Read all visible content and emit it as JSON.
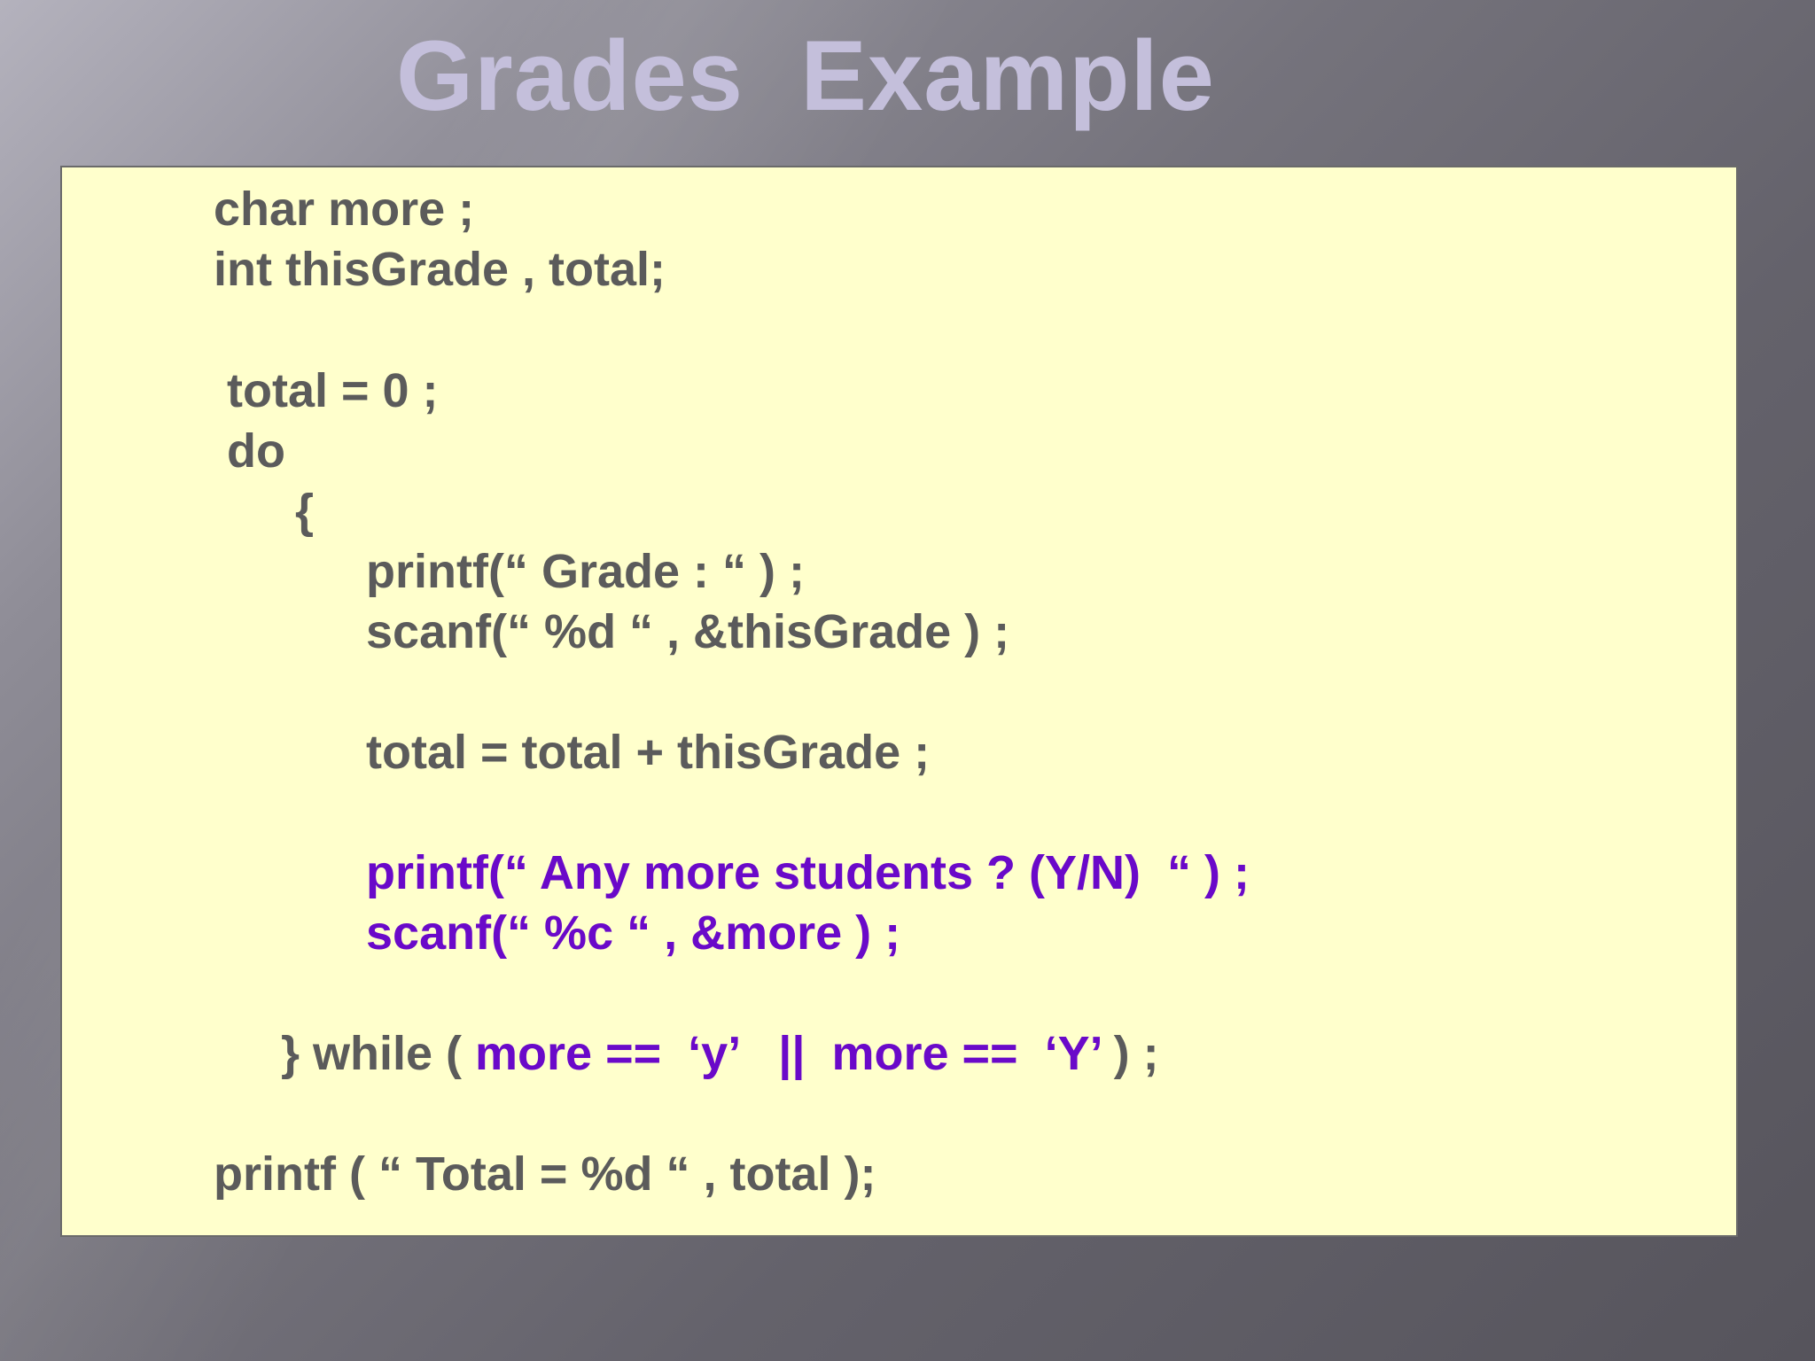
{
  "slide": {
    "title": "Grades  Example"
  },
  "code": {
    "line_1": "char more ;",
    "line_2": "int thisGrade , total;",
    "line_3": "total = 0 ;",
    "line_4": "do",
    "line_5": "{",
    "line_6": "printf(“ Grade : “ ) ;",
    "line_7": "scanf(“ %d “ , &thisGrade ) ;",
    "line_8": "total = total + thisGrade ;",
    "line_9": "printf(“ Any more students ? (Y/N)  “ ) ;",
    "line_10": "scanf(“ %c “ , &more ) ;",
    "line_11": {
      "brace_while": "} while ( ",
      "condition": "more ==  ‘y’   ||  more ==  ‘Y’",
      "end": " ) ;"
    },
    "line_12": "printf ( “ Total = %d “ , total );"
  },
  "colors": {
    "background": "#75737c",
    "box_fill": "#ffffcc",
    "code_text": "#5b5b5b",
    "highlight_text": "#6a09c9",
    "title_text": "#c4bfdb"
  }
}
